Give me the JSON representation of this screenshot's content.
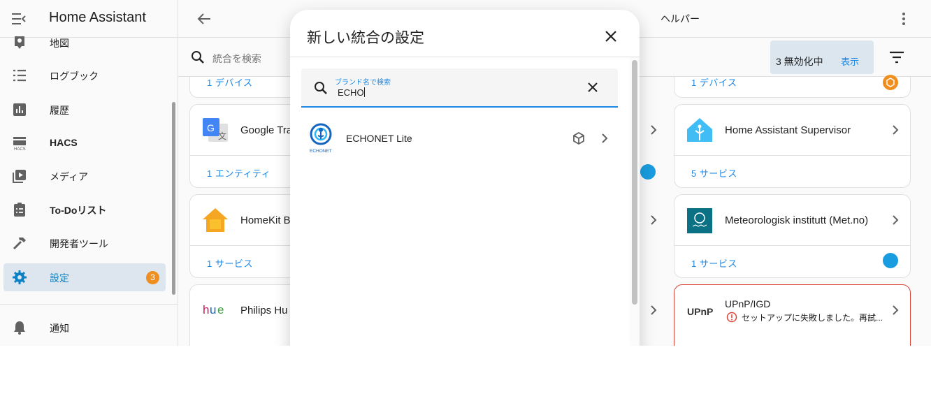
{
  "sidebar": {
    "title": "Home Assistant",
    "items": [
      {
        "label": "地図",
        "icon": "map-marker-icon"
      },
      {
        "label": "ログブック",
        "icon": "list-icon"
      },
      {
        "label": "履歴",
        "icon": "chart-box-icon"
      },
      {
        "label": "HACS",
        "icon": "hacs-icon"
      },
      {
        "label": "メディア",
        "icon": "play-box-icon"
      },
      {
        "label": "To-Doリスト",
        "icon": "clipboard-list-icon"
      },
      {
        "label": "開発者ツール",
        "icon": "hammer-icon"
      },
      {
        "label": "設定",
        "icon": "cog-icon",
        "badge": "3",
        "active": true
      }
    ],
    "notifications_label": "通知"
  },
  "topbar": {
    "tab_title": "ヘルパー"
  },
  "search": {
    "placeholder": "統合を検索",
    "disabled_text": "3 無効化中",
    "disabled_action": "表示"
  },
  "cards": [
    {
      "name": "Google Tra",
      "footer": "1 エンティティ"
    },
    {
      "name": "HomeKit B",
      "footer": "1 サービス"
    },
    {
      "name": "Philips Hu",
      "footer": ""
    },
    {
      "name": "Home Assistant Supervisor",
      "footer": "5 サービス"
    },
    {
      "name": "Meteorologisk institutt (Met.no)",
      "footer": "1 サービス"
    },
    {
      "name": "UPnP/IGD",
      "error": "セットアップに失敗しました。再試..."
    }
  ],
  "top_strips": [
    {
      "footer": "1 デバイス"
    },
    {
      "footer": "1 デバイス"
    }
  ],
  "dialog": {
    "title": "新しい統合の設定",
    "search_label": "ブランド名で検索",
    "search_value": "ECHO",
    "results": [
      {
        "name": "ECHONET Lite",
        "logo_text": "ECHONET"
      }
    ]
  },
  "colors": {
    "accent": "#1e88e5",
    "badge": "#ef8f1f",
    "active_bg": "#dde6ee",
    "error": "#db4437"
  }
}
